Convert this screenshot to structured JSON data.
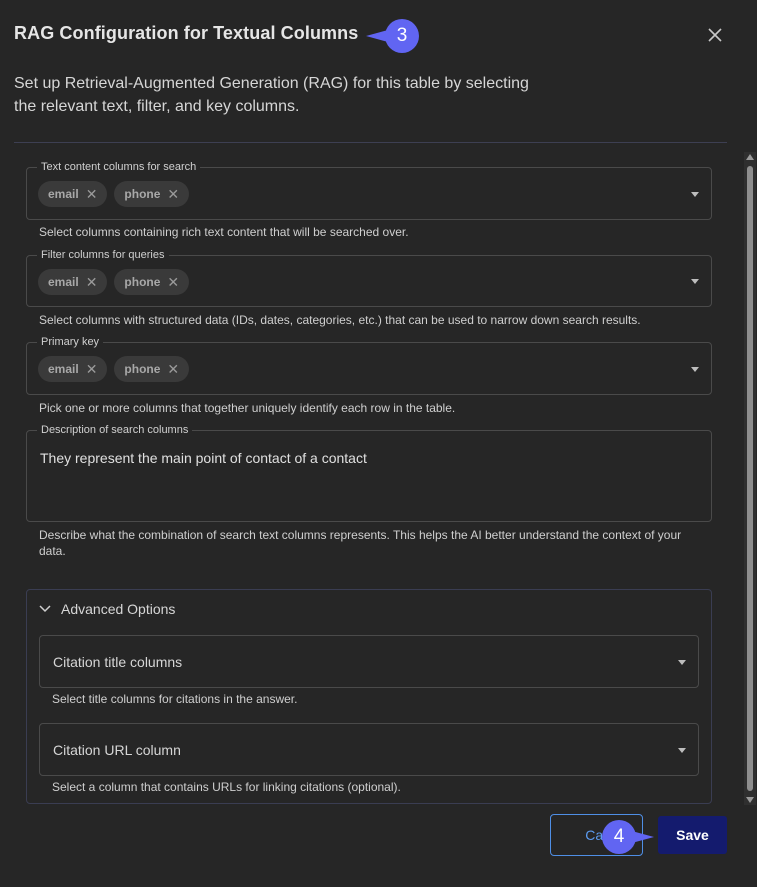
{
  "dialog": {
    "title": "RAG Configuration for Textual Columns",
    "subtitle": "Set up Retrieval-Augmented Generation (RAG) for this table by selecting the relevant text, filter, and key columns."
  },
  "fields": {
    "text_content": {
      "label": "Text content columns for search",
      "chips": [
        "email",
        "phone"
      ],
      "helper": "Select columns containing rich text content that will be searched over."
    },
    "filter": {
      "label": "Filter columns for queries",
      "chips": [
        "email",
        "phone"
      ],
      "helper": "Select columns with structured data (IDs, dates, categories, etc.) that can be used to narrow down search results."
    },
    "primary_key": {
      "label": "Primary key",
      "chips": [
        "email",
        "phone"
      ],
      "helper": "Pick one or more columns that together uniquely identify each row in the table."
    },
    "description": {
      "label": "Description of search columns",
      "value": "They represent the main point of contact of a contact",
      "helper": "Describe what the combination of search text columns represents. This helps the AI better understand the context of your data."
    }
  },
  "advanced": {
    "header": "Advanced Options",
    "citation_title": {
      "placeholder": "Citation title columns",
      "helper": "Select title columns for citations in the answer."
    },
    "citation_url": {
      "placeholder": "Citation URL column",
      "helper": "Select a column that contains URLs for linking citations (optional)."
    }
  },
  "actions": {
    "cancel_label": "Car",
    "save_label": "Save"
  },
  "markers": {
    "step3": "3",
    "step4": "4"
  },
  "colors": {
    "background": "#262626",
    "save_button": "#141b6e",
    "cancel_border": "#4f8fe6",
    "marker": "#6165f2"
  },
  "icons": {
    "close": "close-icon",
    "chip_remove": "x-icon",
    "dropdown": "caret-down-icon",
    "collapse": "chevron-down-icon"
  }
}
